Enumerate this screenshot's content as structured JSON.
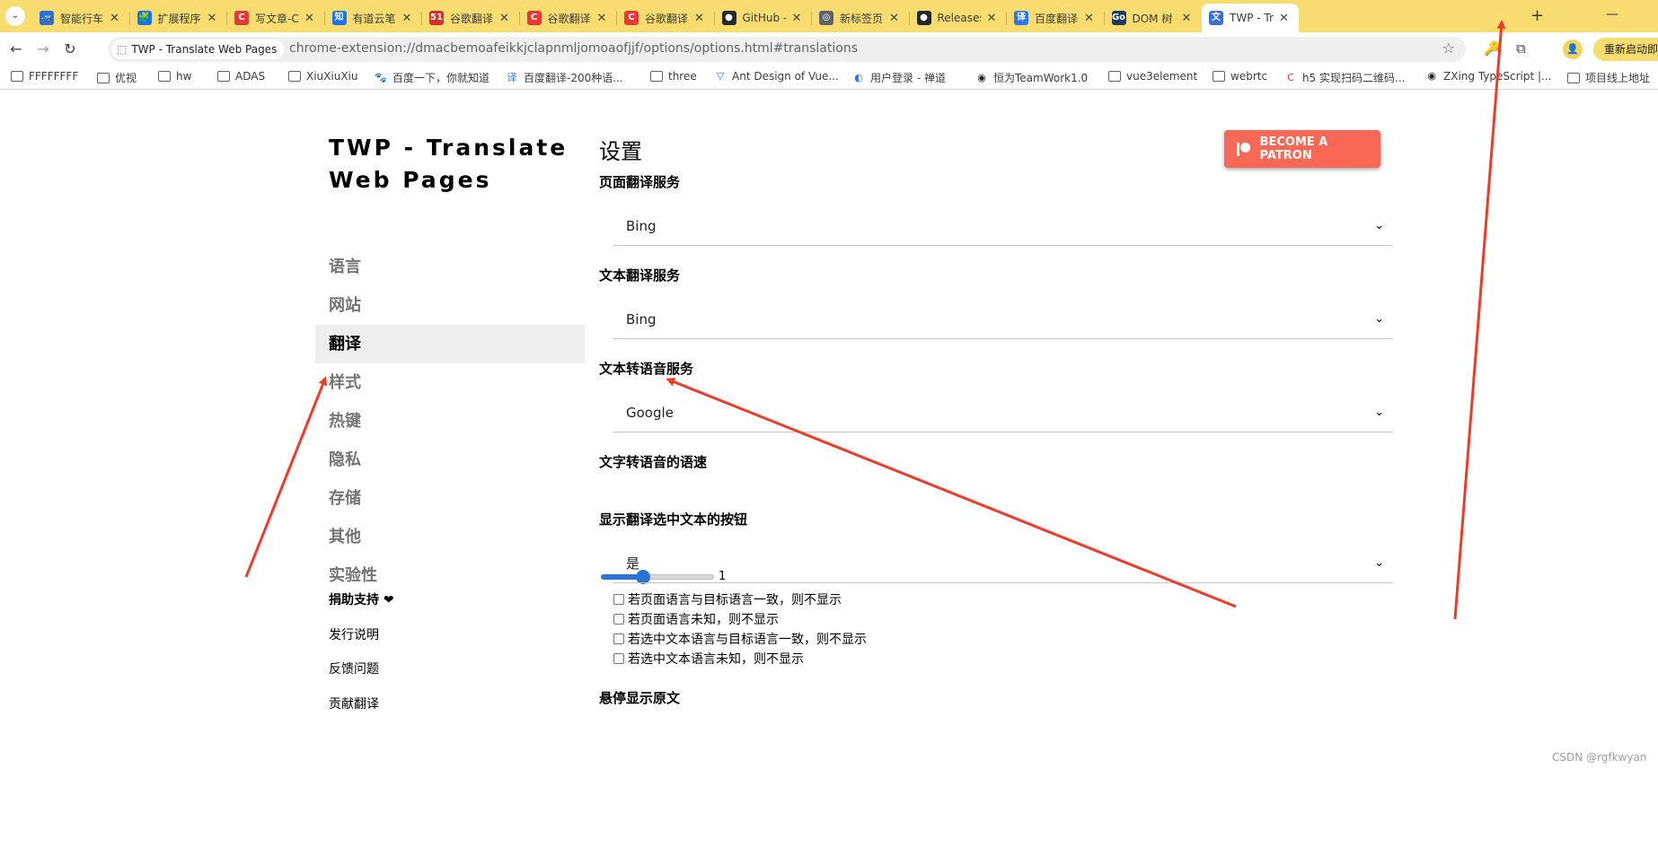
{
  "browser": {
    "tabs": [
      {
        "title": "智能行车",
        "icon": "car-icon",
        "icon_color": "#2d6fd6",
        "glyph": "🚙"
      },
      {
        "title": "扩展程序",
        "icon": "puzzle-icon",
        "icon_color": "#1a73e8",
        "glyph": "🧩"
      },
      {
        "title": "写文章-CS",
        "icon": "csdn-icon",
        "icon_color": "#e53935",
        "glyph": "C"
      },
      {
        "title": "有道云笔",
        "icon": "zhihu-icon",
        "icon_color": "#1772f6",
        "glyph": "知"
      },
      {
        "title": "谷歌翻译",
        "icon": "51cto-icon",
        "icon_color": "#d32f2f",
        "glyph": "51"
      },
      {
        "title": "谷歌翻译",
        "icon": "csdn-icon",
        "icon_color": "#e53935",
        "glyph": "C"
      },
      {
        "title": "谷歌翻译",
        "icon": "csdn-icon",
        "icon_color": "#e53935",
        "glyph": "C"
      },
      {
        "title": "GitHub -",
        "icon": "github-icon",
        "icon_color": "#24292f",
        "glyph": "●"
      },
      {
        "title": "新标签页",
        "icon": "chrome-icon",
        "icon_color": "#5f6368",
        "glyph": "◎"
      },
      {
        "title": "Releases",
        "icon": "github-icon",
        "icon_color": "#24292f",
        "glyph": "●"
      },
      {
        "title": "百度翻译",
        "icon": "baidu-translate-icon",
        "icon_color": "#2a78f4",
        "glyph": "译"
      },
      {
        "title": "DOM 树",
        "icon": "go-icon",
        "icon_color": "#1e3a5f",
        "glyph": "Go"
      },
      {
        "title": "TWP - Tra",
        "icon": "translate-icon",
        "icon_color": "#3b6fd8",
        "glyph": "文",
        "active": true
      }
    ],
    "url_chip": "TWP - Translate Web Pages",
    "url": "chrome-extension://dmacbemoafeikkjclapnmljomoaofjjf/options/options.html#translations",
    "relaunch_label": "重新启动即",
    "bookmarks": [
      {
        "label": "FFFFFFFF",
        "icon": "folder-icon"
      },
      {
        "label": "优视",
        "icon": "folder-icon"
      },
      {
        "label": "hw",
        "icon": "folder-icon"
      },
      {
        "label": "ADAS",
        "icon": "folder-icon"
      },
      {
        "label": "XiuXiuXiu",
        "icon": "folder-icon"
      },
      {
        "label": "百度一下，你就知道",
        "icon": "baidu-paw-icon"
      },
      {
        "label": "百度翻译-200种语...",
        "icon": "baidu-translate-icon"
      },
      {
        "label": "three",
        "icon": "folder-icon"
      },
      {
        "label": "Ant Design of Vue...",
        "icon": "antd-icon"
      },
      {
        "label": "用户登录 - 禅道",
        "icon": "zentao-icon"
      },
      {
        "label": "恒为TeamWork1.0",
        "icon": "globe-icon"
      },
      {
        "label": "vue3element",
        "icon": "folder-icon"
      },
      {
        "label": "webrtc",
        "icon": "folder-icon"
      },
      {
        "label": "h5 实现扫码二维码...",
        "icon": "csdn-icon"
      },
      {
        "label": "ZXing TypeScript |...",
        "icon": "globe-icon"
      },
      {
        "label": "项目线上地址",
        "icon": "folder-icon"
      }
    ]
  },
  "page": {
    "brand_line1": "TWP - Translate",
    "brand_line2": "Web Pages",
    "nav": [
      {
        "label": "语言",
        "active": false
      },
      {
        "label": "网站",
        "active": false
      },
      {
        "label": "翻译",
        "active": true
      },
      {
        "label": "样式",
        "active": false
      },
      {
        "label": "热键",
        "active": false
      },
      {
        "label": "隐私",
        "active": false
      },
      {
        "label": "存储",
        "active": false
      },
      {
        "label": "其他",
        "active": false
      },
      {
        "label": "实验性",
        "active": false
      }
    ],
    "footer": {
      "donate": "捐助支持 ❤",
      "release_notes": "发行说明",
      "feedback": "反馈问题",
      "contribute": "贡献翻译"
    },
    "title": "设置",
    "patron_label": "BECOME A PATRON",
    "page_service": {
      "label": "页面翻译服务",
      "value": "Bing"
    },
    "text_service": {
      "label": "文本翻译服务",
      "value": "Bing"
    },
    "tts_service": {
      "label": "文本转语音服务",
      "value": "Google"
    },
    "tts_speed": {
      "label": "文字转语音的语速",
      "value": 1,
      "min": 0.5,
      "max": 1.5
    },
    "show_button": {
      "label": "显示翻译选中文本的按钮",
      "value": "是"
    },
    "checkboxes": [
      {
        "label": "若页面语言与目标语言一致，则不显示",
        "checked": false
      },
      {
        "label": "若页面语言未知，则不显示",
        "checked": false
      },
      {
        "label": "若选中文本语言与目标语言一致，则不显示",
        "checked": false
      },
      {
        "label": "若选中文本语言未知，则不显示",
        "checked": false
      }
    ],
    "hover_label": "悬停显示原文"
  },
  "watermark": "CSDN @rgfkwyan",
  "annotation_color": "#f03a2a"
}
